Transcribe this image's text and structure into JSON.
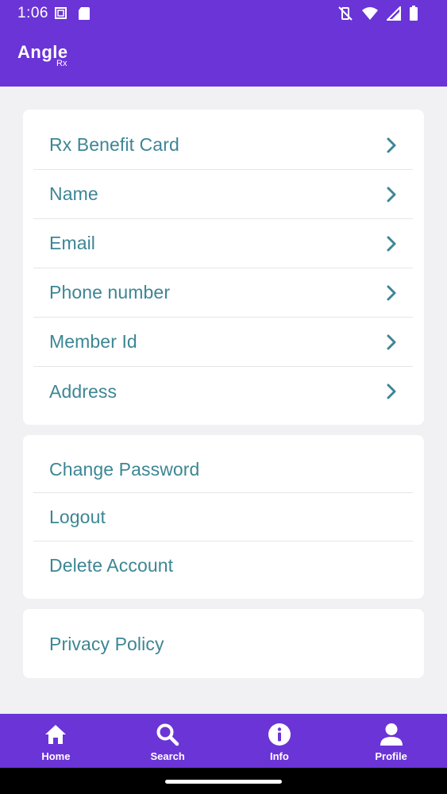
{
  "status_bar": {
    "time": "1:06",
    "icons_left": [
      "screenshot-icon",
      "sd-card-icon"
    ],
    "icons_right": [
      "vibrate-off-icon",
      "wifi-icon",
      "signal-icon",
      "battery-icon"
    ]
  },
  "app_bar": {
    "logo_main": "Angle",
    "logo_sub": "Rx"
  },
  "profile_section": {
    "items": [
      {
        "label": "Rx Benefit Card",
        "icon": "chevron-right-icon"
      },
      {
        "label": "Name",
        "icon": "chevron-right-icon"
      },
      {
        "label": "Email",
        "icon": "chevron-right-icon"
      },
      {
        "label": "Phone number",
        "icon": "chevron-right-icon"
      },
      {
        "label": "Member Id",
        "icon": "chevron-right-icon"
      },
      {
        "label": "Address",
        "icon": "chevron-right-icon"
      }
    ]
  },
  "account_section": {
    "items": [
      {
        "label": "Change Password"
      },
      {
        "label": "Logout"
      },
      {
        "label": "Delete Account"
      }
    ]
  },
  "legal_section": {
    "items": [
      {
        "label": "Privacy Policy"
      }
    ]
  },
  "bottom_nav": {
    "items": [
      {
        "label": "Home",
        "icon": "home-icon"
      },
      {
        "label": "Search",
        "icon": "search-icon"
      },
      {
        "label": "Info",
        "icon": "info-icon"
      },
      {
        "label": "Profile",
        "icon": "profile-icon"
      }
    ]
  },
  "colors": {
    "brand_purple": "#6b34d6",
    "item_text": "#3d8694",
    "background": "#f1f1f3"
  }
}
